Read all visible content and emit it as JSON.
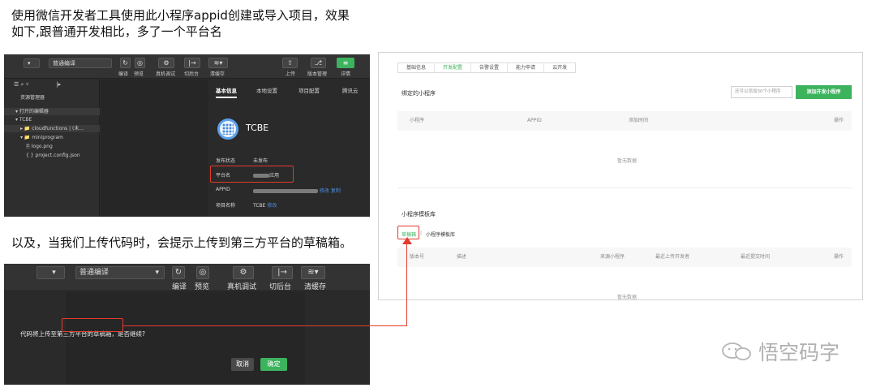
{
  "intro": {
    "line1": "使用微信开发者工具使用此小程序appid创建或导入项目，效果",
    "line2": "如下,跟普通开发相比，多了一个平台名",
    "line3": "以及，当我们上传代码时，会提示上传到第三方平台的草稿箱。"
  },
  "ide_top": {
    "mode_select": "普通编译",
    "labels": [
      "编译",
      "预览",
      "真机调试",
      "切后台",
      "清缓存",
      "上传",
      "版本管理",
      "详情"
    ],
    "explorer_title": "资源管理器",
    "tree": [
      "▾ 打开的编辑器",
      "▾ TCBE",
      "▸ 📁 cloudfunctions | (未...",
      "▾ 📁 miniprogram",
      "🖹 logo.png",
      "{ } project.config.json"
    ],
    "detail_tabs": [
      "基本信息",
      "本地设置",
      "项目配置",
      "腾讯云"
    ],
    "app_name": "TCBE",
    "rows": [
      {
        "k": "发布状态",
        "v": "未发布"
      },
      {
        "k": "平台名",
        "v": "应用"
      },
      {
        "k": "APPID",
        "v": "",
        "links": "修改 复制"
      },
      {
        "k": "项目名称",
        "v": "TCBE",
        "links": "修改"
      }
    ]
  },
  "ide_bottom": {
    "mode_select": "普通编译",
    "labels": [
      "编译",
      "预览",
      "真机调试",
      "切后台",
      "清缓存"
    ],
    "message": "代码将上传至第三方平台的草稿箱，是否继续?",
    "cancel": "取消",
    "confirm": "确定"
  },
  "panel": {
    "tabs": [
      "基础信息",
      "开发配置",
      "告警设置",
      "能力申请",
      "云开发"
    ],
    "bound_title": "绑定的小程序",
    "bound_hint": "还可以添加30个小程序",
    "add_button": "添加开发小程序",
    "bound_cols": [
      "小程序",
      "APPID",
      "添加时间",
      "操作"
    ],
    "empty": "暂无数据",
    "template_title": "小程序模板库",
    "seg_draft": "草稿箱",
    "seg_sep": "|",
    "seg_lib": "小程序模板库",
    "template_cols": [
      "版本号",
      "描述",
      "来源小程序",
      "最近上传开发者",
      "最近提交时间",
      "操作"
    ]
  },
  "watermark": "悟空码字",
  "colors": {
    "accent": "#3db35e",
    "highlight": "#e23c2c",
    "link": "#4d8fe0"
  }
}
